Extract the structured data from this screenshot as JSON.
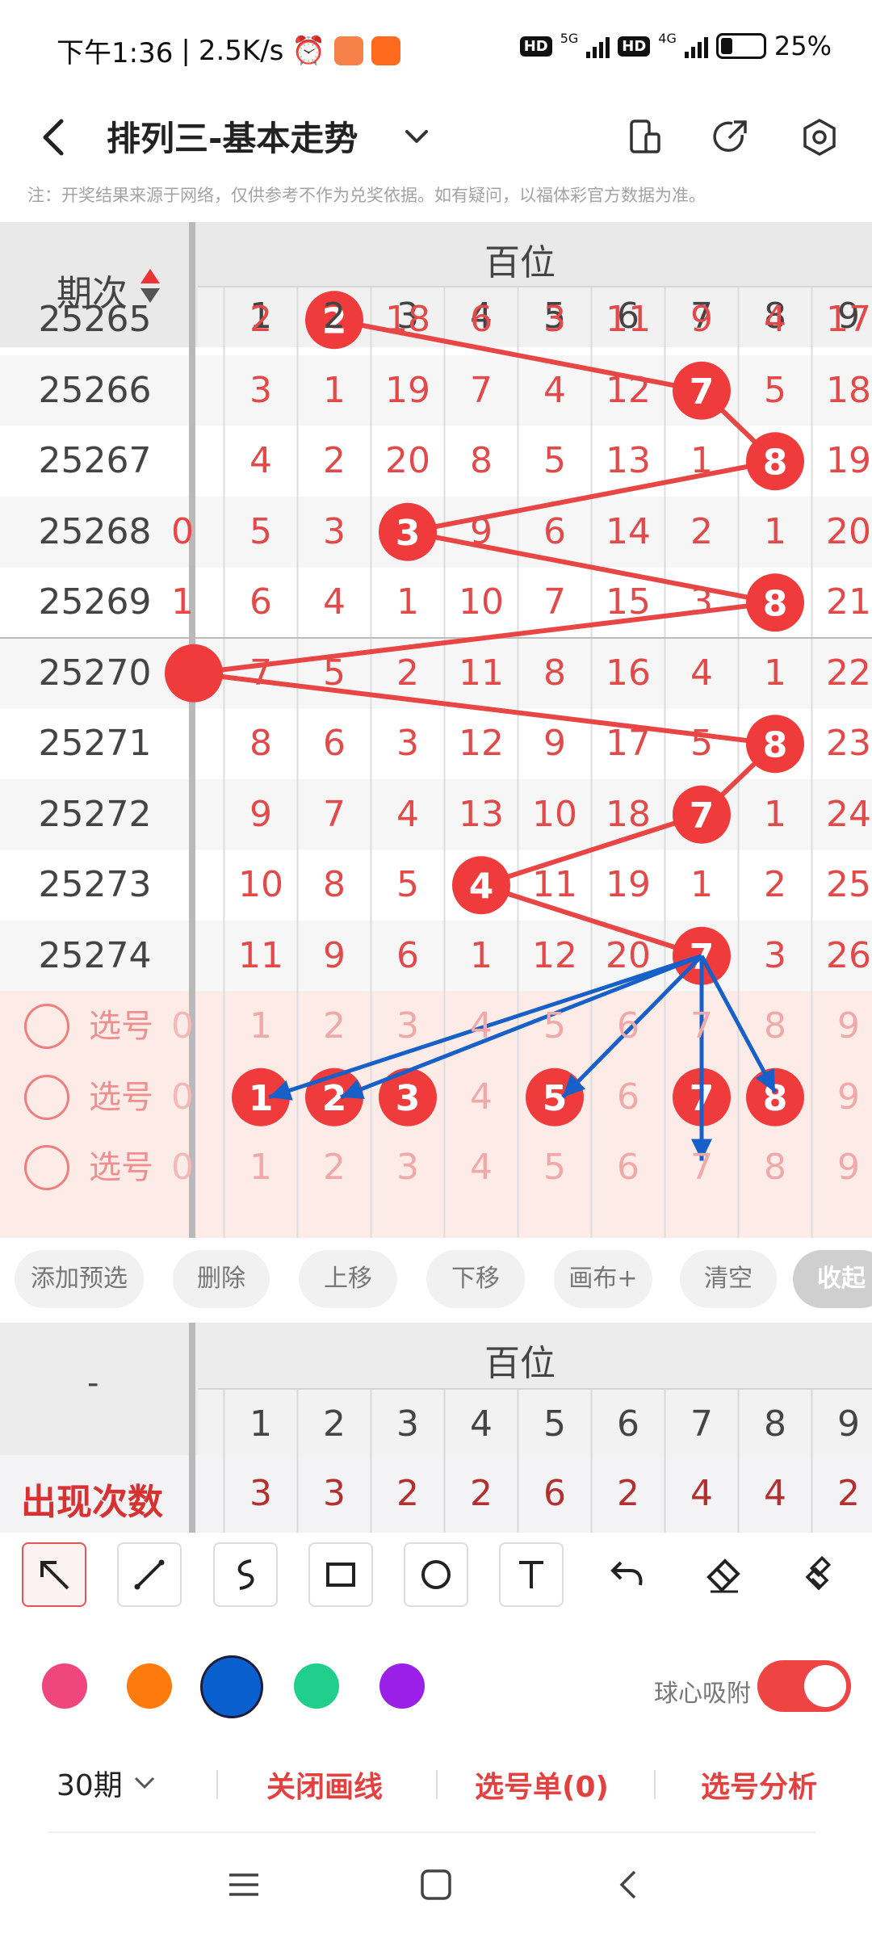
{
  "status_bar": {
    "time": "下午1:36",
    "speed": "2.5K/s",
    "net1": "5G",
    "net2": "4G",
    "hd1": "HD",
    "hd2": "HD",
    "battery": "25%"
  },
  "header": {
    "title": "排列三-基本走势"
  },
  "notice": "注：开奖结果来源于网络，仅供参考不作为兑奖依据。如有疑问，以福体彩官方数据为准。",
  "grid": {
    "period_header": "期次",
    "position_header": "百位",
    "columns": [
      "1",
      "2",
      "3",
      "4",
      "5",
      "6",
      "7",
      "8",
      "9"
    ],
    "rows": [
      {
        "period": "25265",
        "left": "",
        "cells": [
          "2",
          "2",
          "18",
          "6",
          "3",
          "11",
          "9",
          "4",
          "17"
        ],
        "hit": 2
      },
      {
        "period": "25266",
        "left": "",
        "cells": [
          "3",
          "1",
          "19",
          "7",
          "4",
          "12",
          "7",
          "5",
          "18"
        ],
        "hit": 7
      },
      {
        "period": "25267",
        "left": "",
        "cells": [
          "4",
          "2",
          "20",
          "8",
          "5",
          "13",
          "1",
          "8",
          "19"
        ],
        "hit": 8
      },
      {
        "period": "25268",
        "left": "0",
        "cells": [
          "5",
          "3",
          "3",
          "9",
          "6",
          "14",
          "2",
          "1",
          "20"
        ],
        "hit": 3
      },
      {
        "period": "25269",
        "left": "1",
        "cells": [
          "6",
          "4",
          "1",
          "10",
          "7",
          "15",
          "3",
          "8",
          "21"
        ],
        "hit": 8
      },
      {
        "period": "25270",
        "left": "",
        "cells": [
          "7",
          "5",
          "2",
          "11",
          "8",
          "16",
          "4",
          "1",
          "22"
        ],
        "hit": 0
      },
      {
        "period": "25271",
        "left": "",
        "cells": [
          "8",
          "6",
          "3",
          "12",
          "9",
          "17",
          "5",
          "8",
          "23"
        ],
        "hit": 8
      },
      {
        "period": "25272",
        "left": "",
        "cells": [
          "9",
          "7",
          "4",
          "13",
          "10",
          "18",
          "7",
          "1",
          "24"
        ],
        "hit": 7
      },
      {
        "period": "25273",
        "left": "",
        "cells": [
          "10",
          "8",
          "5",
          "4",
          "11",
          "19",
          "1",
          "2",
          "25"
        ],
        "hit": 4
      },
      {
        "period": "25274",
        "left": "",
        "cells": [
          "11",
          "9",
          "6",
          "1",
          "12",
          "20",
          "7",
          "3",
          "26"
        ],
        "hit": 7
      }
    ],
    "pick_rows": [
      {
        "label": "选号",
        "selected": []
      },
      {
        "label": "选号",
        "selected": [
          1,
          2,
          3,
          5,
          7,
          8
        ]
      },
      {
        "label": "选号",
        "selected": []
      }
    ]
  },
  "buttons": [
    "添加预选",
    "删除",
    "上移",
    "下移",
    "画布+",
    "清空",
    "收起"
  ],
  "stats": {
    "corner": "-",
    "position_header": "百位",
    "columns": [
      "1",
      "2",
      "3",
      "4",
      "5",
      "6",
      "7",
      "8",
      "9"
    ],
    "row_label": "出现次数",
    "counts": [
      "3",
      "3",
      "2",
      "2",
      "6",
      "2",
      "4",
      "4",
      "2"
    ]
  },
  "tools": [
    "arrow-tool",
    "line-tool",
    "curve-tool",
    "rect-tool",
    "circle-tool",
    "text-tool",
    "undo-tool",
    "eraser-tool",
    "clear-brush-tool"
  ],
  "colors": [
    "#f0467e",
    "#ff7a0d",
    "#0a5fcf",
    "#1fcf8b",
    "#9a20e8"
  ],
  "selected_color": "#0a5fcf",
  "snap": {
    "label": "球心吸附",
    "on": true
  },
  "bottom": {
    "periods": "30期",
    "close_draw": "关闭画线",
    "pick_list": "选号单(0)",
    "analysis": "选号分析"
  }
}
